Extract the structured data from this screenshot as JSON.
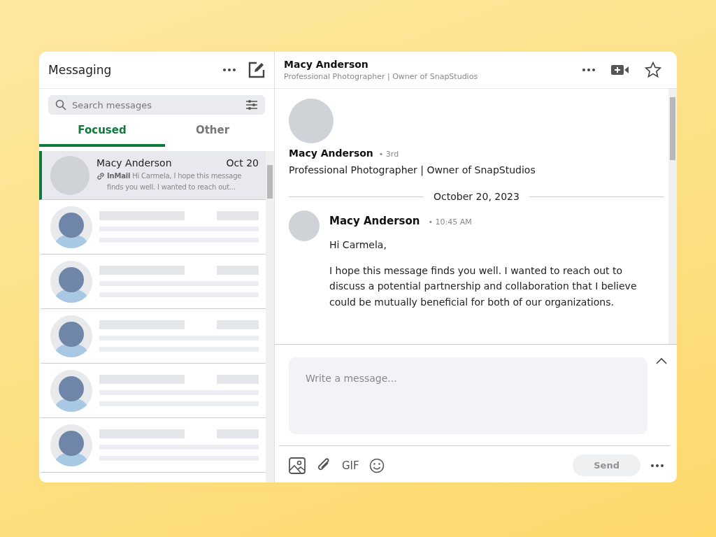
{
  "sidebar": {
    "title": "Messaging",
    "search": {
      "placeholder": "Search messages"
    },
    "tabs": [
      {
        "label": "Focused",
        "selected": true
      },
      {
        "label": "Other",
        "selected": false
      }
    ],
    "conversations": [
      {
        "kind": "message",
        "selected": true,
        "name": "Macy Anderson",
        "date": "Oct 20",
        "tag": "InMail",
        "preview": "Hi Carmela, I hope this message finds you well. I wanted to reach out..."
      },
      {
        "kind": "placeholder",
        "selected": false
      },
      {
        "kind": "placeholder",
        "selected": false
      },
      {
        "kind": "placeholder",
        "selected": false
      },
      {
        "kind": "placeholder",
        "selected": false
      },
      {
        "kind": "placeholder",
        "selected": false
      }
    ]
  },
  "conversation": {
    "name": "Macy Anderson",
    "headline": "Professional Photographer | Owner of SnapStudios",
    "profile": {
      "name": "Macy Anderson",
      "degree": "• 3rd",
      "headline": "Professional Photographer | Owner of SnapStudios"
    },
    "date_divider": "October 20, 2023",
    "messages": [
      {
        "sender": "Macy Anderson",
        "time": "• 10:45 AM",
        "paragraphs": [
          "Hi Carmela,",
          "I hope this message finds you well. I wanted to reach out to discuss a potential partnership and collaboration that I believe could be mutually beneficial for both of our organizations."
        ]
      }
    ],
    "compose": {
      "placeholder": "Write a message...",
      "gif": "GIF",
      "send": {
        "label": "Send",
        "disabled": true
      }
    }
  }
}
